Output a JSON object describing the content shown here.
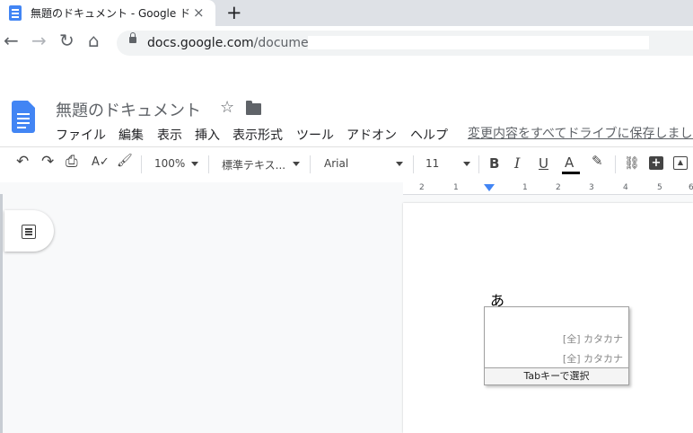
{
  "browser": {
    "tab_title": "無題のドキュメント - Google ドキュメント",
    "tab_close": "×",
    "new_tab": "+",
    "url_host": "docs.google.com",
    "url_path": "/document/",
    "nav": {
      "back": "←",
      "forward": "→",
      "reload": "↻",
      "home": "⌂"
    }
  },
  "docs": {
    "title": "無題のドキュメント",
    "star": "☆",
    "menu": [
      "ファイル",
      "編集",
      "表示",
      "挿入",
      "表示形式",
      "ツール",
      "アドオン",
      "ヘルプ"
    ],
    "save_status": "変更内容をすべてドライブに保存しました"
  },
  "toolbar": {
    "undo": "↶",
    "redo": "↷",
    "print": "⎙",
    "spellcheck": "A✓",
    "paint_format": "🖌",
    "zoom": "100%",
    "style": "標準テキス...",
    "font": "Arial",
    "font_size": "11",
    "bold": "B",
    "italic": "I",
    "underline": "U",
    "text_color": "A",
    "highlight": "✎",
    "link": "⛓",
    "insert_comment": "+",
    "image": "▲"
  },
  "ruler": {
    "labels": [
      "2",
      "1",
      "1",
      "2",
      "3",
      "4",
      "5",
      "6"
    ]
  },
  "document": {
    "typed_text": "あ"
  },
  "ime": {
    "candidates": [
      "[全] カタカナ",
      "[全] カタカナ"
    ],
    "footer": "Tabキーで選択"
  },
  "colors": {
    "docs_blue": "#4285f4",
    "text_color_bar": "#000000"
  }
}
